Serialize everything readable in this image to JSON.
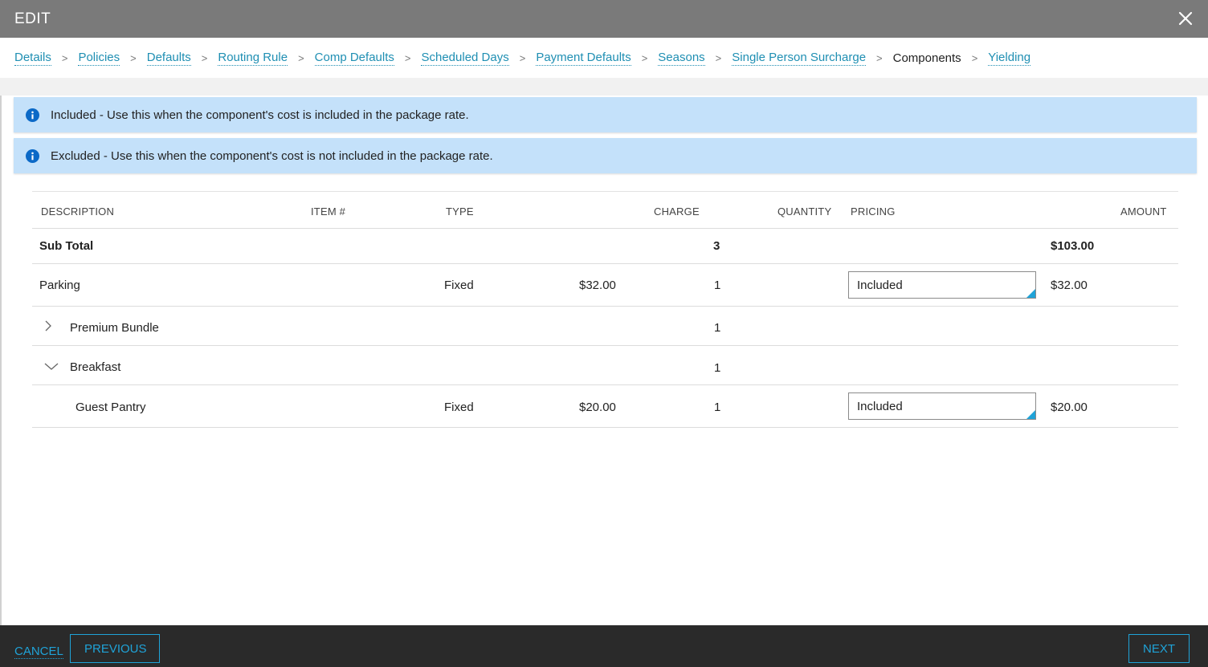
{
  "window": {
    "title": "EDIT"
  },
  "breadcrumbs": [
    {
      "label": "Details"
    },
    {
      "label": "Policies"
    },
    {
      "label": "Defaults"
    },
    {
      "label": "Routing Rule"
    },
    {
      "label": "Comp Defaults"
    },
    {
      "label": "Scheduled Days"
    },
    {
      "label": "Payment Defaults"
    },
    {
      "label": "Seasons"
    },
    {
      "label": "Single Person Surcharge"
    },
    {
      "label": "Components"
    },
    {
      "label": "Yielding"
    }
  ],
  "breadcrumb_separator": ">",
  "alerts": [
    {
      "text": "Included - Use this when the component's cost is included in the package rate."
    },
    {
      "text": "Excluded - Use this when the component's cost is not included in the package rate."
    }
  ],
  "table": {
    "headers": {
      "description": "DESCRIPTION",
      "item": "ITEM #",
      "type": "TYPE",
      "charge": "CHARGE",
      "quantity": "QUANTITY",
      "pricing": "PRICING",
      "amount": "AMOUNT"
    },
    "subtotal": {
      "label": "Sub Total",
      "quantity": "3",
      "amount": "$103.00"
    },
    "rows": [
      {
        "description": "Parking",
        "type": "Fixed",
        "charge": "$32.00",
        "quantity": "1",
        "pricing": "Included",
        "amount": "$32.00"
      },
      {
        "description": "Premium Bundle",
        "quantity": "1"
      },
      {
        "description": "Breakfast",
        "quantity": "1"
      },
      {
        "description": "Guest Pantry",
        "type": "Fixed",
        "charge": "$20.00",
        "quantity": "1",
        "pricing": "Included",
        "amount": "$20.00"
      }
    ]
  },
  "footer": {
    "cancel_label": "CANCEL",
    "previous_label": "PREVIOUS",
    "next_label": "NEXT"
  },
  "colors": {
    "accent": "#1fa3d8",
    "link": "#1f8fb3",
    "titlebar": "#7a7a7a",
    "alert_bg": "#c4e1fa",
    "info_icon": "#0b69c7",
    "footer_bg": "#2a2a2a"
  },
  "icons": {
    "close": "close-icon",
    "info": "info-icon",
    "expand": "chevron-right-icon",
    "collapse": "chevron-down-icon"
  }
}
